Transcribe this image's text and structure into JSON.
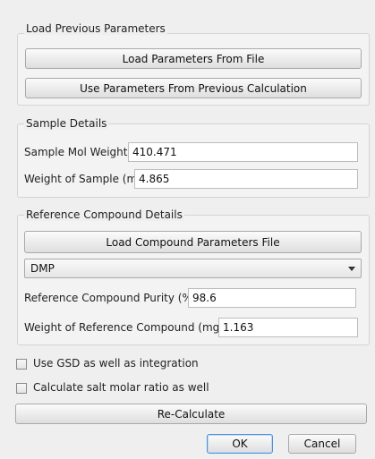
{
  "load_previous": {
    "title": "Load Previous Parameters",
    "load_file_button": "Load Parameters From File",
    "use_previous_button": "Use Parameters From Previous Calculation"
  },
  "sample": {
    "title": "Sample Details",
    "mol_weight_label": "Sample Mol Weight",
    "mol_weight_value": "410.471",
    "weight_label": "Weight of Sample (mg)",
    "weight_value": "4.865"
  },
  "reference": {
    "title": "Reference Compound Details",
    "load_button": "Load Compound Parameters File",
    "compound_selected": "DMP",
    "purity_label": "Reference Compound Purity (%)",
    "purity_value": "98.6",
    "weight_label": "Weight of Reference Compound (mg)",
    "weight_value": "1.163"
  },
  "options": {
    "use_gsd_label": "Use GSD as well as integration",
    "use_gsd_checked": false,
    "salt_ratio_label": "Calculate salt molar ratio as well",
    "salt_ratio_checked": false
  },
  "actions": {
    "recalculate": "Re-Calculate",
    "ok": "OK",
    "cancel": "Cancel"
  }
}
